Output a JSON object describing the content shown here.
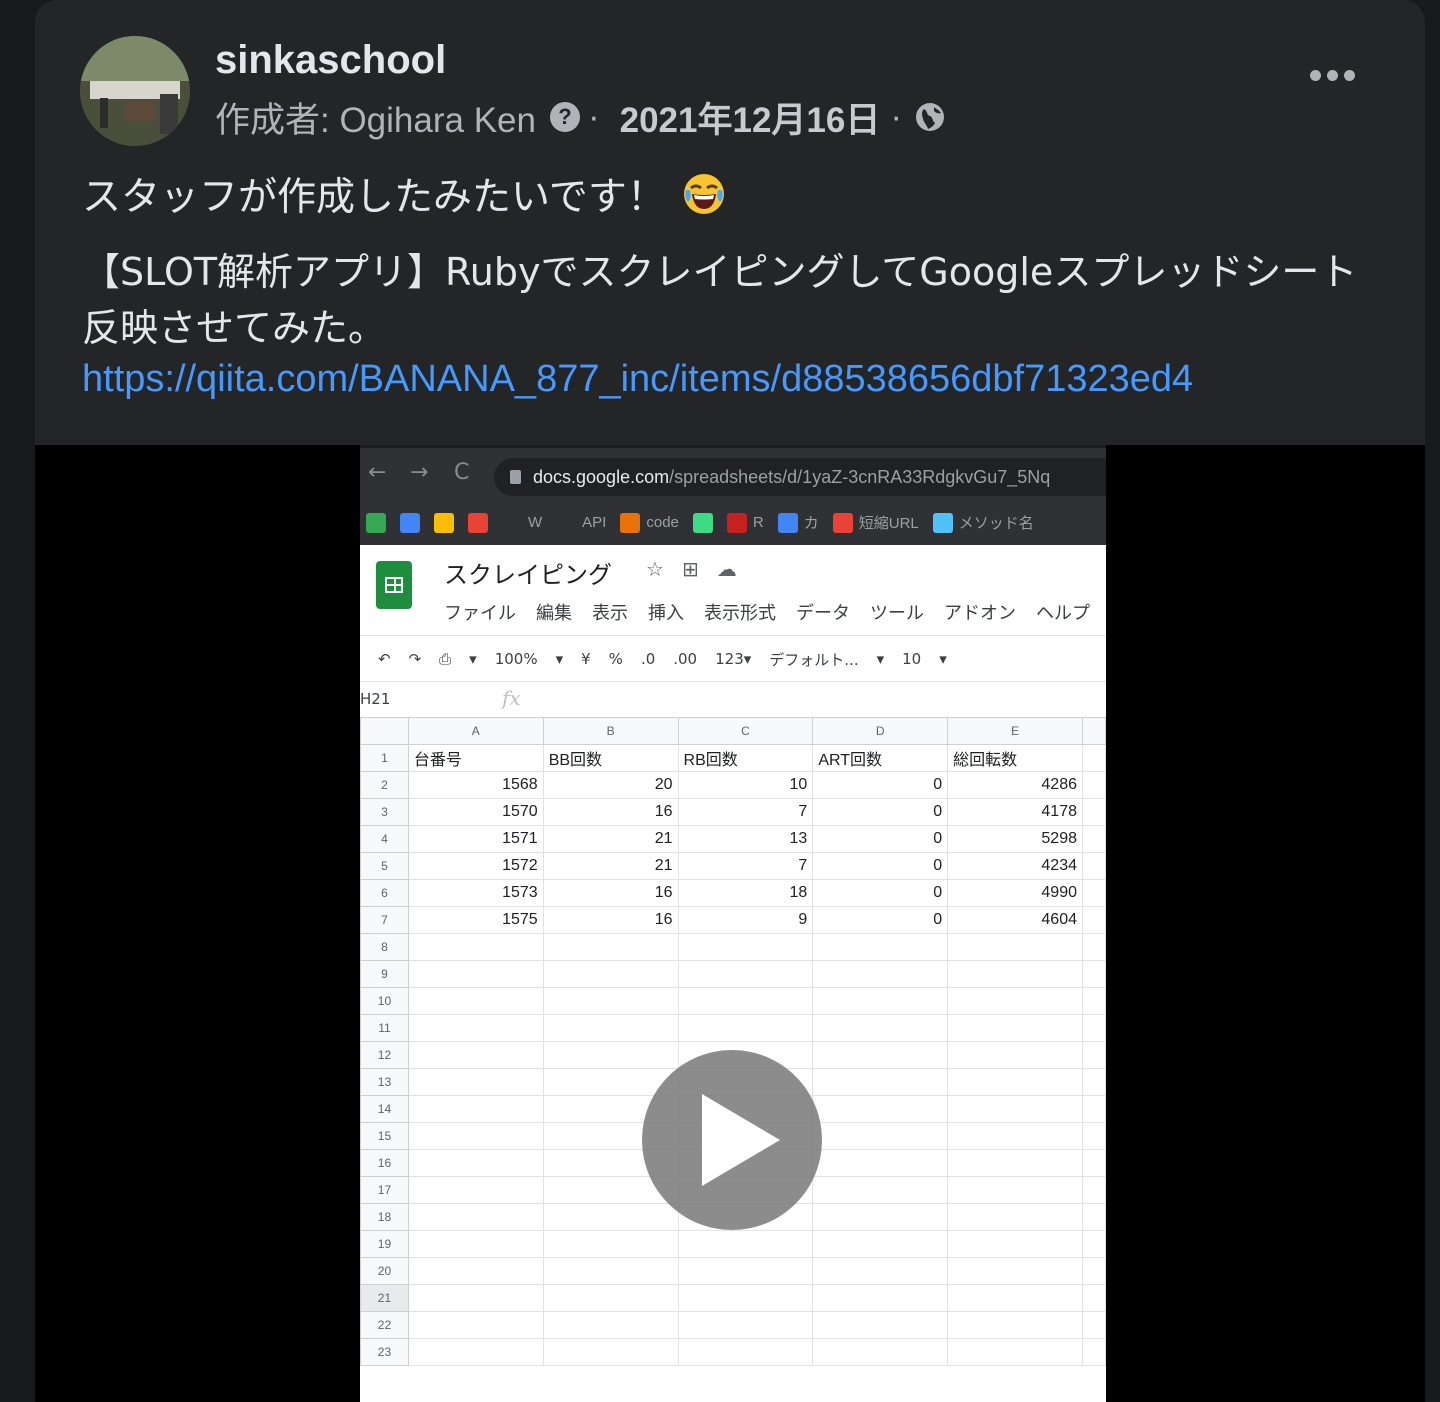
{
  "post": {
    "author": "sinkaschool",
    "byline": "作成者: Ogihara Ken",
    "help_icon": "?",
    "date": "2021年12月16日",
    "separator": "·",
    "text_line1": "スタッフが作成したみたいです！",
    "text_line2": "【SLOT解析アプリ】RubyでスクレイピングしてGoogleスプレッドシート反映させてみた。",
    "link": "https://qiita.com/BANANA_877_inc/items/d88538656dbf71323ed4",
    "icons": [
      "question-icon",
      "globe-icon",
      "more-options-icon",
      "laughing-emoji-icon",
      "play-icon"
    ]
  },
  "video": {
    "browser": {
      "back": "←",
      "forward": "→",
      "reload": "C",
      "url_host": "docs.google.com",
      "url_path": "/spreadsheets/d/1yaZ-3cnRA33RdgkvGu7_5Nq",
      "bookmarks": [
        {
          "label": "",
          "color": "#34a853"
        },
        {
          "label": "",
          "color": "#4285f4"
        },
        {
          "label": "",
          "color": "#fbbc04"
        },
        {
          "label": "",
          "color": "#ea4335"
        },
        {
          "label": "W",
          "color": "#303134"
        },
        {
          "label": "API",
          "color": "#303134"
        },
        {
          "label": "code",
          "color": "#e8710a"
        },
        {
          "label": "",
          "color": "#3ddc84"
        },
        {
          "label": "R",
          "color": "#c5221f"
        },
        {
          "label": "カ",
          "color": "#4285f4"
        },
        {
          "label": "短縮URL",
          "color": "#ea4335"
        },
        {
          "label": "メソッド名",
          "color": "#4fc3f7"
        }
      ]
    },
    "sheet": {
      "title": "スクレイピング",
      "header_icons": [
        "☆",
        "⊞",
        "☁"
      ],
      "menu": [
        "ファイル",
        "編集",
        "表示",
        "挿入",
        "表示形式",
        "データ",
        "ツール",
        "アドオン",
        "ヘルプ"
      ],
      "toolbar": [
        "↶",
        "↷",
        "⎙",
        "▾",
        "100%",
        "▾",
        "¥",
        "%",
        ".0",
        ".00",
        "123▾",
        "デフォルト...",
        "▾",
        "10",
        "▾"
      ],
      "cell_ref": "H21",
      "fx": "fx",
      "columns": [
        "A",
        "B",
        "C",
        "D",
        "E"
      ],
      "header_row": [
        "台番号",
        "BB回数",
        "RB回数",
        "ART回数",
        "総回転数"
      ],
      "rows": [
        [
          "1568",
          "20",
          "10",
          "0",
          "4286"
        ],
        [
          "1570",
          "16",
          "7",
          "0",
          "4178"
        ],
        [
          "1571",
          "21",
          "13",
          "0",
          "5298"
        ],
        [
          "1572",
          "21",
          "7",
          "0",
          "4234"
        ],
        [
          "1573",
          "16",
          "18",
          "0",
          "4990"
        ],
        [
          "1575",
          "16",
          "9",
          "0",
          "4604"
        ]
      ],
      "row_numbers": [
        "1",
        "2",
        "3",
        "4",
        "5",
        "6",
        "7",
        "8",
        "9",
        "10",
        "11",
        "12",
        "13",
        "14",
        "15",
        "16",
        "17",
        "18",
        "19",
        "20",
        "21",
        "22",
        "23"
      ]
    }
  }
}
